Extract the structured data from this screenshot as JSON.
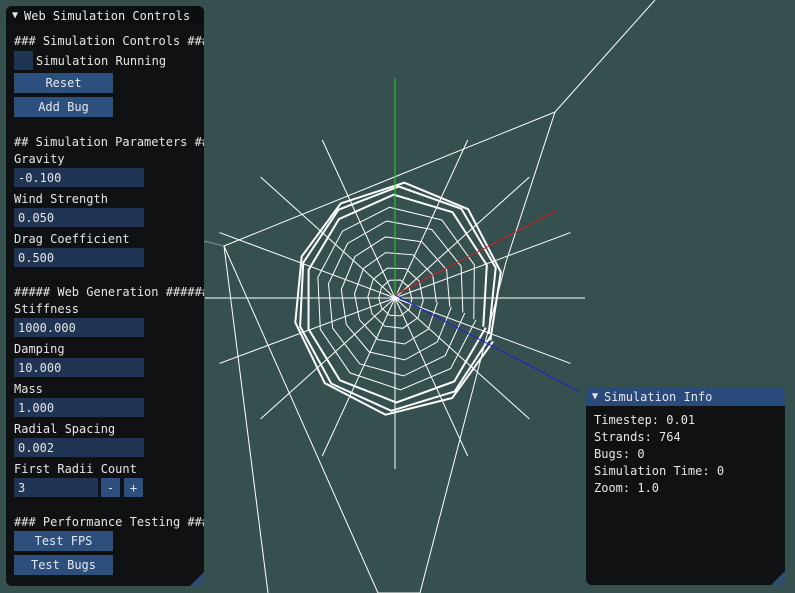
{
  "controls": {
    "title": "Web Simulation Controls",
    "sim_header": "### Simulation Controls ###",
    "running_label": "Simulation Running",
    "reset_label": "Reset",
    "add_bug_label": "Add Bug",
    "params_header": "## Simulation Parameters ##",
    "gravity_label": "Gravity",
    "gravity_value": "-0.100",
    "wind_label": "Wind Strength",
    "wind_value": "0.050",
    "drag_label": "Drag Coefficient",
    "drag_value": "0.500",
    "gen_header": "##### Web Generation ######",
    "stiffness_label": "Stiffness",
    "stiffness_value": "1000.000",
    "damping_label": "Damping",
    "damping_value": "10.000",
    "mass_label": "Mass",
    "mass_value": "1.000",
    "radial_label": "Radial Spacing",
    "radial_value": "0.002",
    "radii_label": "First Radii Count",
    "radii_value": "3",
    "minus_label": "-",
    "plus_label": "+",
    "perf_header": "### Performance Testing ###",
    "fps_label": "Test FPS",
    "bugs_label": "Test Bugs"
  },
  "info": {
    "title": "Simulation Info",
    "timestep": "Timestep: 0.01",
    "strands": "Strands: 764",
    "bugs": "Bugs: 0",
    "sim_time": "Simulation Time: 0",
    "zoom": "Zoom: 1.0"
  },
  "colors": {
    "background": "#365050",
    "panel": "#101112",
    "accent": "#2c4f7e",
    "web": "#ffffff",
    "axis_x": "#d02020",
    "axis_y": "#20d020",
    "axis_z": "#2020d0"
  }
}
